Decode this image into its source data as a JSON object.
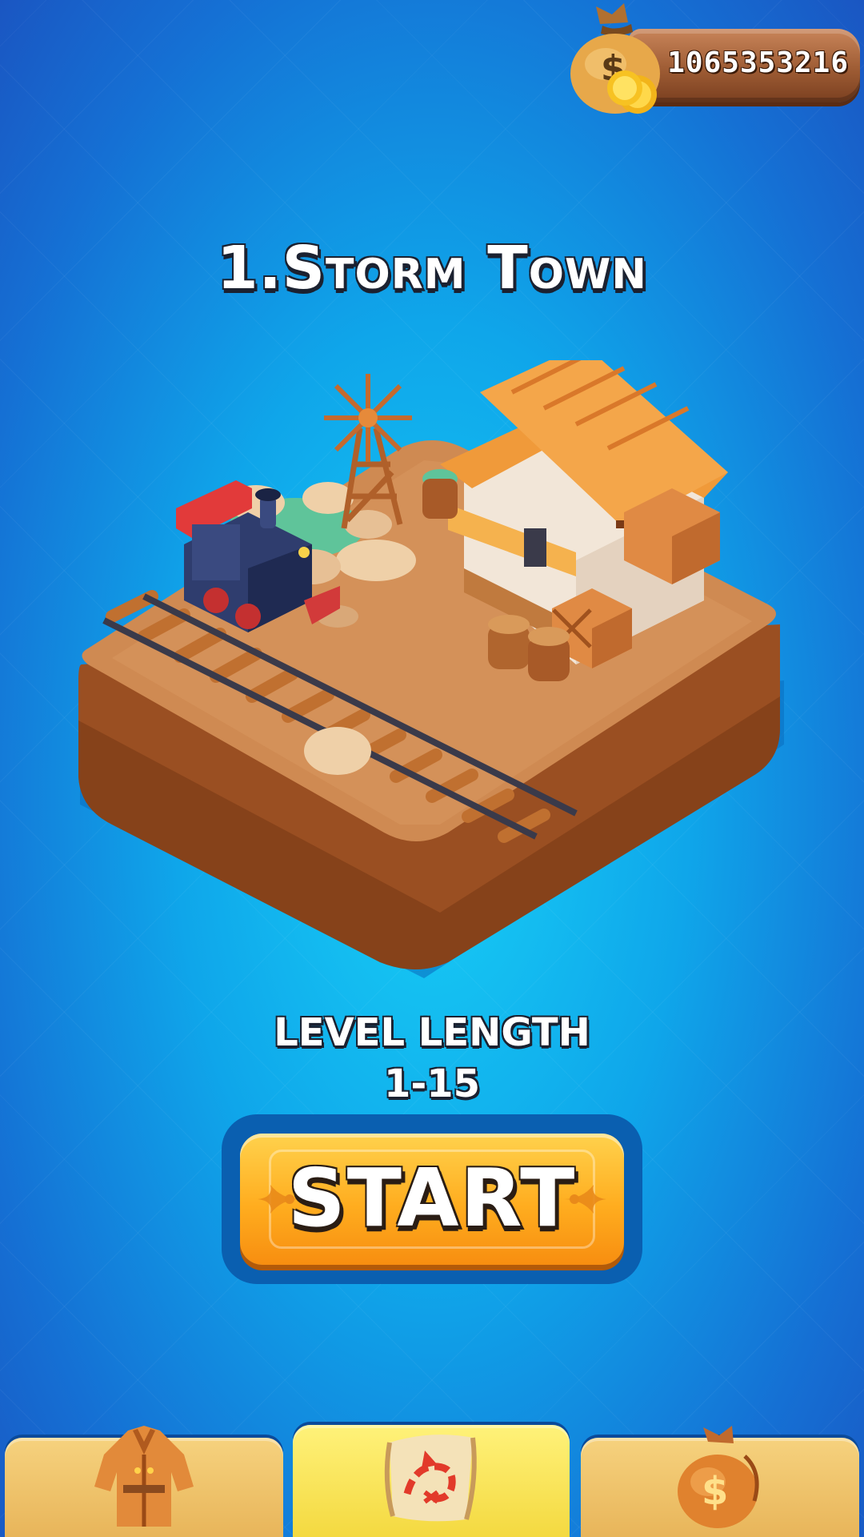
{
  "currency": {
    "amount": "1065353216",
    "icon": "money-bag-icon"
  },
  "level": {
    "title": "1.Storm Town",
    "length_label": "LEVEL LENGTH",
    "length_value": "1-15",
    "scene": "island-scene"
  },
  "start_button": {
    "label": "START"
  },
  "bottom_nav": {
    "tabs": [
      {
        "id": "outfits",
        "icon": "coat-icon",
        "active": false
      },
      {
        "id": "map",
        "icon": "map-scroll-icon",
        "active": true
      },
      {
        "id": "shop",
        "icon": "money-bag-icon",
        "active": false
      }
    ]
  },
  "colors": {
    "background": "#12a8ea",
    "button": "#ffad1f",
    "plank": "#9e5c34",
    "active_tab": "#f7e04a",
    "tab": "#eec06a"
  }
}
